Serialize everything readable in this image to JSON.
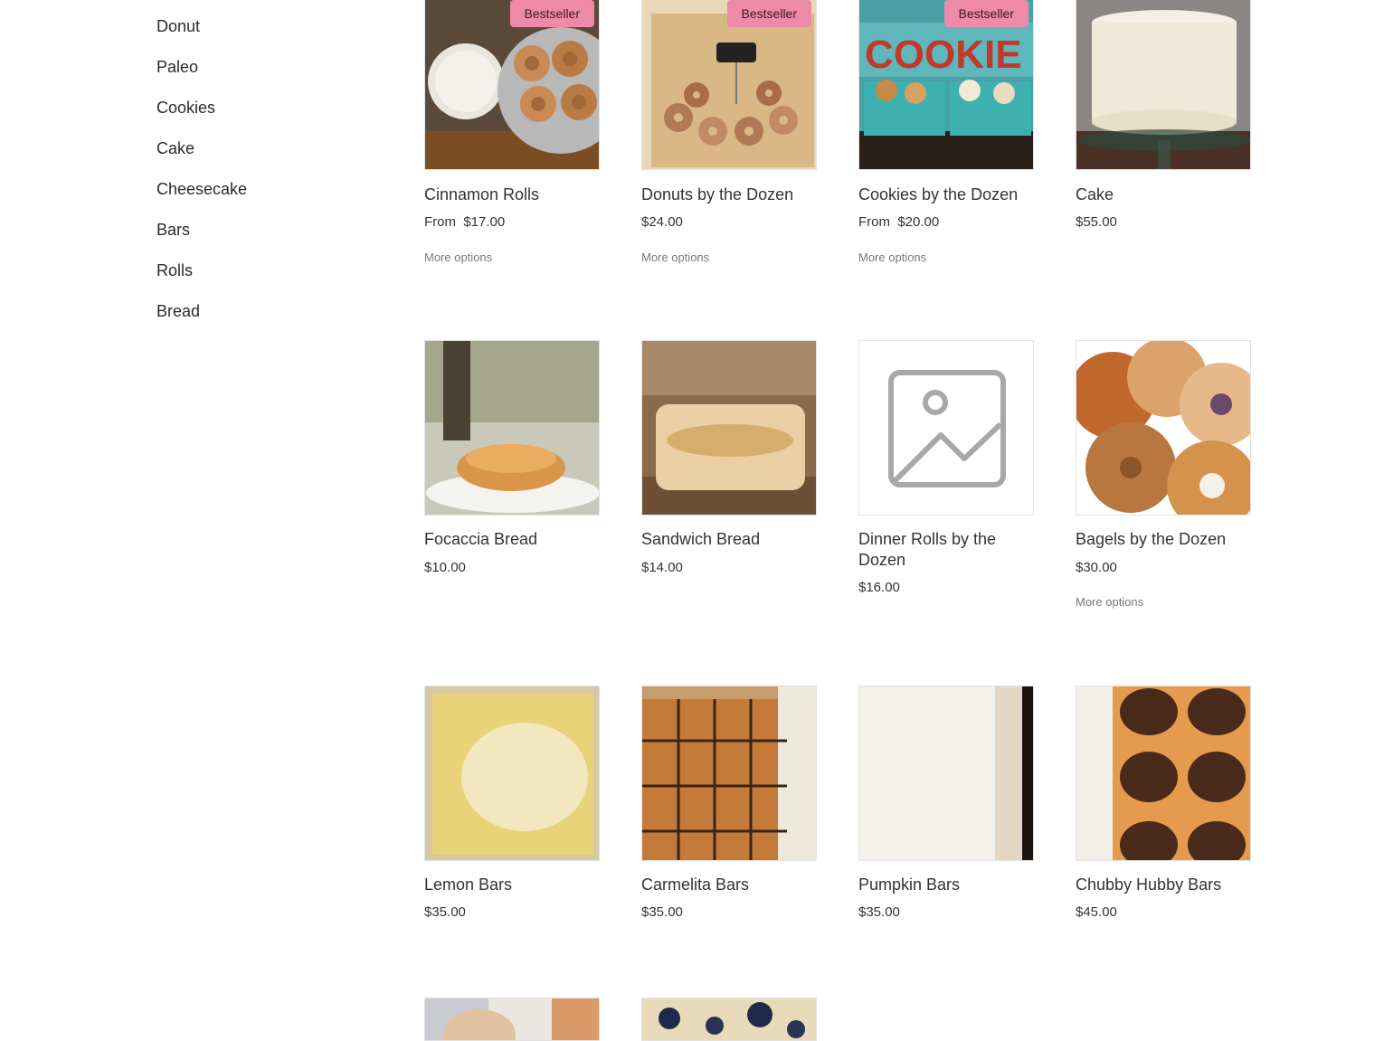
{
  "sidebar": {
    "categories": [
      "Donut",
      "Paleo",
      "Cookies",
      "Cake",
      "Cheesecake",
      "Bars",
      "Rolls",
      "Bread"
    ]
  },
  "colors": {
    "badge_bg": "#ee8aa8",
    "text": "#333333",
    "muted": "#777777"
  },
  "products": [
    {
      "name": "Cinnamon Rolls",
      "price": "From  $17.00",
      "badge": "Bestseller",
      "more": "More options",
      "image": "cinnamon-rolls-photo"
    },
    {
      "name": "Donuts by the Dozen",
      "price": "$24.00",
      "badge": "Bestseller",
      "more": "More options",
      "image": "donuts-photo"
    },
    {
      "name": "Cookies by the Dozen",
      "price": "From  $20.00",
      "badge": "Bestseller",
      "more": "More options",
      "image": "cookies-photo"
    },
    {
      "name": "Cake",
      "price": "$55.00",
      "image": "cake-photo"
    },
    {
      "name": "Focaccia Bread",
      "price": "$10.00",
      "image": "focaccia-photo"
    },
    {
      "name": "Sandwich Bread",
      "price": "$14.00",
      "image": "sandwich-bread-photo"
    },
    {
      "name": "Dinner Rolls by the Dozen",
      "price": "$16.00",
      "image": "image-placeholder-icon"
    },
    {
      "name": "Bagels by the Dozen",
      "price": "$30.00",
      "more": "More options",
      "image": "bagels-photo"
    },
    {
      "name": "Lemon Bars",
      "price": "$35.00",
      "image": "lemon-bars-photo"
    },
    {
      "name": "Carmelita Bars",
      "price": "$35.00",
      "image": "carmelita-bars-photo"
    },
    {
      "name": "Pumpkin Bars",
      "price": "$35.00",
      "image": "pumpkin-bars-photo"
    },
    {
      "name": "Chubby Hubby Bars",
      "price": "$45.00",
      "image": "chubby-hubby-bars-photo"
    },
    {
      "image": "partial-product-photo-1"
    },
    {
      "image": "partial-product-photo-2"
    }
  ]
}
